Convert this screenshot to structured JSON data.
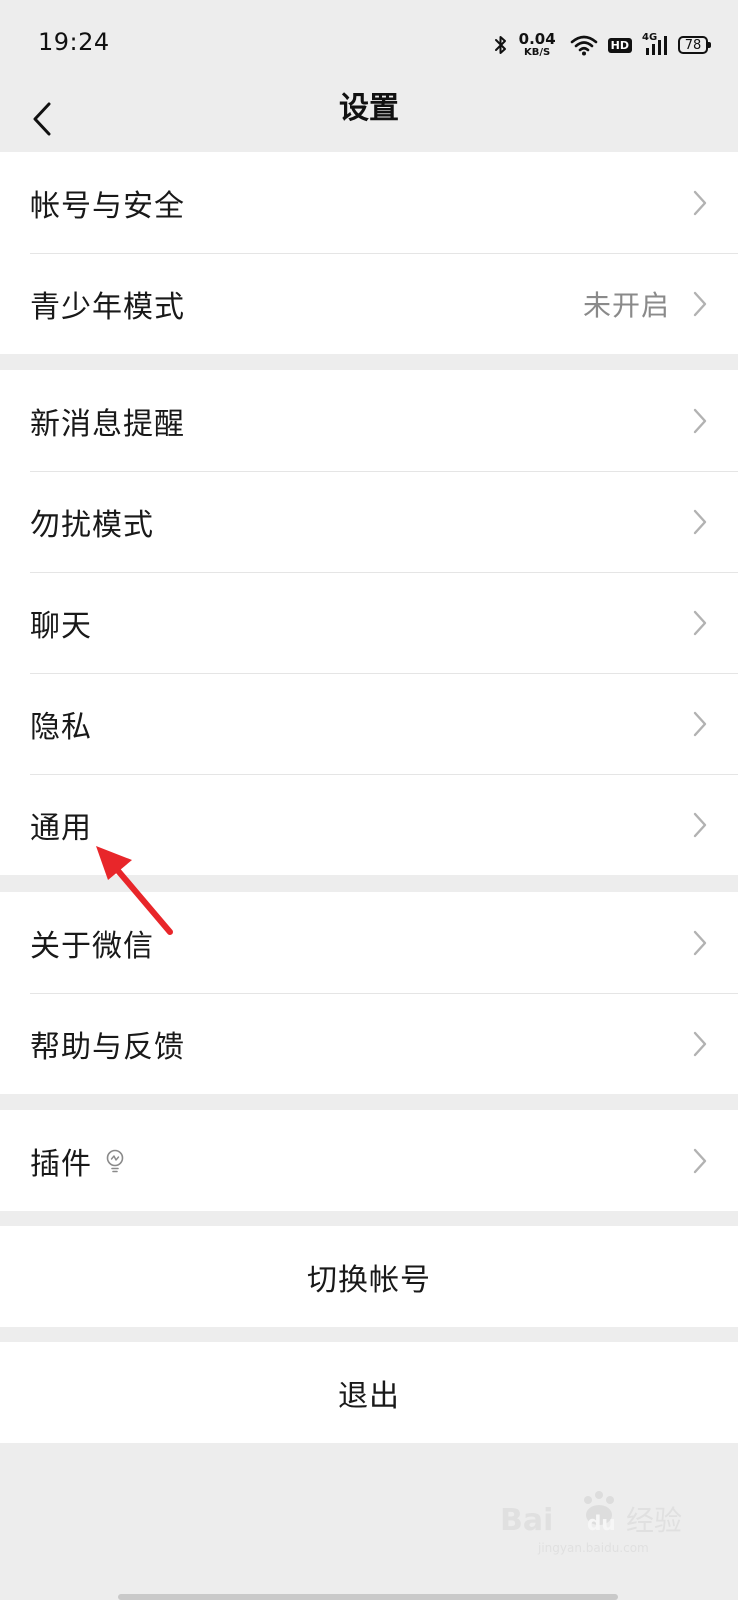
{
  "status_bar": {
    "time": "19:24",
    "net_speed_value": "0.04",
    "net_speed_unit": "KB/S",
    "hd_label": "HD",
    "signal_label": "4G",
    "battery_level": "78"
  },
  "nav": {
    "title": "设置"
  },
  "groups": [
    {
      "items": [
        {
          "label": "帐号与安全"
        },
        {
          "label": "青少年模式",
          "value": "未开启"
        }
      ]
    },
    {
      "items": [
        {
          "label": "新消息提醒"
        },
        {
          "label": "勿扰模式"
        },
        {
          "label": "聊天"
        },
        {
          "label": "隐私"
        },
        {
          "label": "通用"
        }
      ]
    },
    {
      "items": [
        {
          "label": "关于微信"
        },
        {
          "label": "帮助与反馈"
        }
      ]
    },
    {
      "items": [
        {
          "label": "插件"
        }
      ]
    }
  ],
  "actions": {
    "switch_account": "切换帐号",
    "logout": "退出"
  },
  "watermark": {
    "brand_latin": "Bai",
    "brand_du": "du",
    "brand_cn": "经验",
    "domain": "jingyan.baidu.com"
  },
  "colors": {
    "background": "#ededed",
    "card": "#ffffff",
    "text": "#191919",
    "secondary_text": "#8a8a8a",
    "chevron": "#b2b2b2",
    "annotation": "#e8262a"
  },
  "icons": {
    "back": "chevron-left-icon",
    "row_arrow": "chevron-right-icon",
    "plugin": "lightbulb-icon",
    "bluetooth": "bluetooth-icon",
    "wifi": "wifi-icon",
    "signal": "cellular-signal-icon",
    "battery": "battery-icon"
  }
}
